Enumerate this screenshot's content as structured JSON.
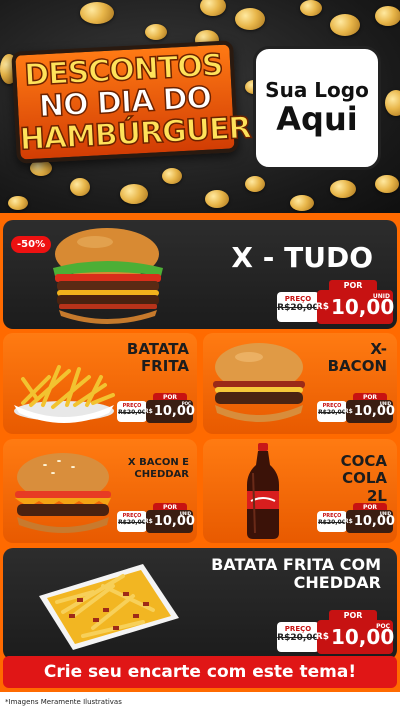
{
  "header": {
    "title_line1": "DESCONTOS",
    "title_line2": "NO DIA DO",
    "title_line3": "HAMBÚRGUER",
    "logo_line1": "Sua Logo",
    "logo_line2": "Aqui"
  },
  "products": [
    {
      "name": "X - TUDO",
      "discount_badge": "-50%",
      "por": "POR",
      "preco_label": "PREÇO",
      "old_price": "R$20,00",
      "currency": "R$",
      "new_price": "10,00",
      "unit": "UNID"
    },
    {
      "name": "BATATA FRITA",
      "por": "POR",
      "preco_label": "PREÇO",
      "old_price": "R$20,00",
      "currency": "R$",
      "new_price": "10,00",
      "unit": "POÇ"
    },
    {
      "name": "X-BACON",
      "por": "POR",
      "preco_label": "PREÇO",
      "old_price": "R$20,00",
      "currency": "R$",
      "new_price": "10,00",
      "unit": "UNID"
    },
    {
      "name": "X BACON E CHEDDAR",
      "por": "POR",
      "preco_label": "PREÇO",
      "old_price": "R$20,00",
      "currency": "R$",
      "new_price": "10,00",
      "unit": "UNID"
    },
    {
      "name": "COCA COLA 2L",
      "por": "POR",
      "preco_label": "PREÇO",
      "old_price": "R$20,00",
      "currency": "R$",
      "new_price": "10,00",
      "unit": "UNID"
    },
    {
      "name": "BATATA FRITA COM CHEDDAR",
      "por": "POR",
      "preco_label": "PREÇO",
      "old_price": "R$20,00",
      "currency": "R$",
      "new_price": "10,00",
      "unit": "POÇ"
    }
  ],
  "footer": {
    "cta": "Crie seu encarte com este tema!",
    "disclaimer": "*Imagens Meramente Ilustrativas"
  },
  "colors": {
    "orange": "#ff6a00",
    "red": "#c71212",
    "dark": "#1c1c1c"
  }
}
